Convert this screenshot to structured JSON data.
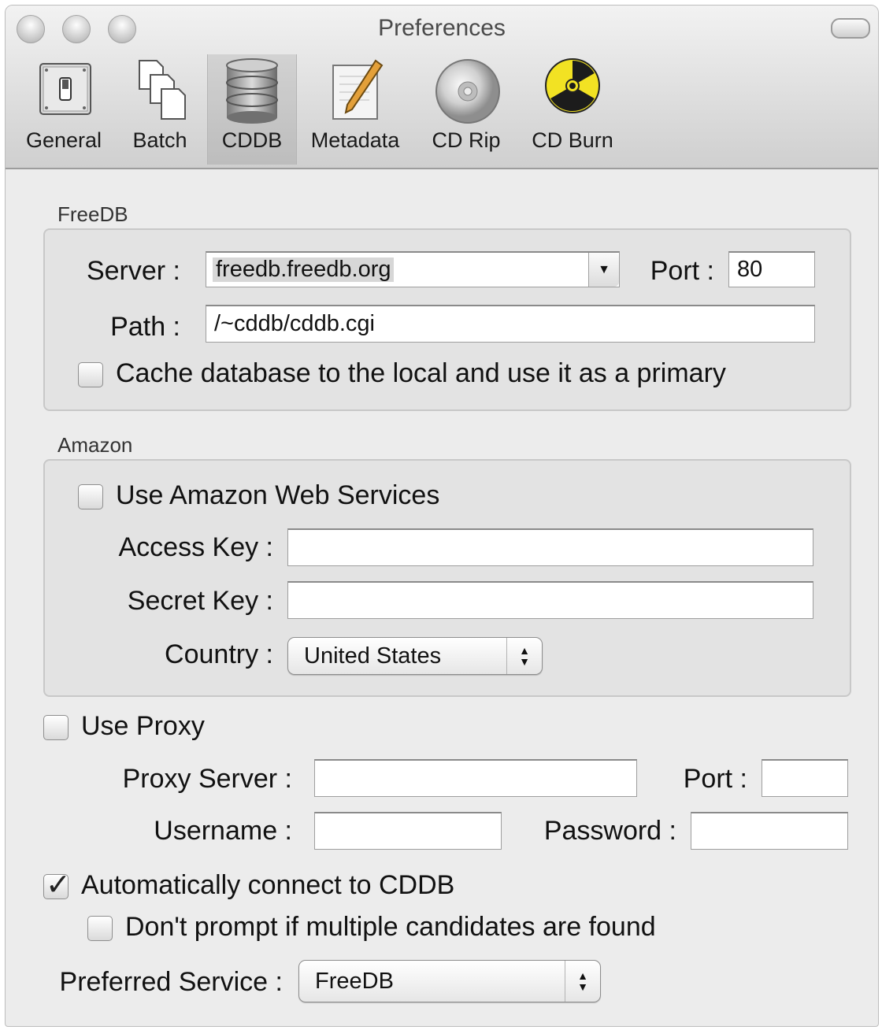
{
  "window": {
    "title": "Preferences"
  },
  "toolbar": {
    "items": [
      {
        "label": "General",
        "icon": "general-switch-icon"
      },
      {
        "label": "Batch",
        "icon": "batch-documents-icon"
      },
      {
        "label": "CDDB",
        "icon": "database-icon",
        "selected": true
      },
      {
        "label": "Metadata",
        "icon": "metadata-pencil-icon"
      },
      {
        "label": "CD Rip",
        "icon": "cd-icon"
      },
      {
        "label": "CD Burn",
        "icon": "radiation-icon"
      }
    ]
  },
  "freedb": {
    "section_label": "FreeDB",
    "server_label": "Server :",
    "server_value": "freedb.freedb.org",
    "port_label": "Port :",
    "port_value": "80",
    "path_label": "Path :",
    "path_value": "/~cddb/cddb.cgi",
    "cache_label": "Cache database to the local and use it as a primary",
    "cache_checked": false
  },
  "amazon": {
    "section_label": "Amazon",
    "use_aws_label": "Use Amazon Web Services",
    "use_aws_checked": false,
    "access_key_label": "Access Key :",
    "access_key_value": "",
    "secret_key_label": "Secret Key :",
    "secret_key_value": "",
    "country_label": "Country :",
    "country_value": "United States"
  },
  "proxy": {
    "use_proxy_label": "Use Proxy",
    "use_proxy_checked": false,
    "server_label": "Proxy Server :",
    "server_value": "",
    "port_label": "Port :",
    "port_value": "",
    "username_label": "Username :",
    "username_value": "",
    "password_label": "Password :",
    "password_value": ""
  },
  "options": {
    "auto_connect_label": "Automatically connect to CDDB",
    "auto_connect_checked": true,
    "dont_prompt_label": "Don't prompt if multiple candidates are found",
    "dont_prompt_checked": false,
    "preferred_service_label": "Preferred Service :",
    "preferred_service_value": "FreeDB"
  },
  "glyphs": {
    "check": "✓",
    "combo_arrow": "▼",
    "popup_up": "▲",
    "popup_down": "▼"
  }
}
